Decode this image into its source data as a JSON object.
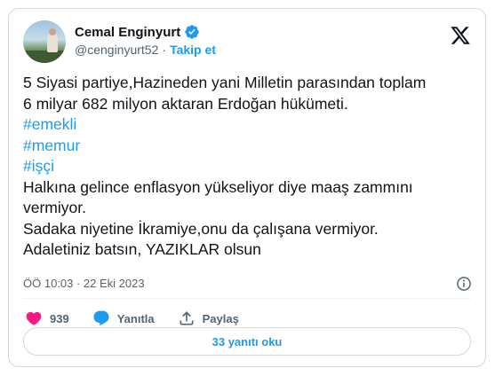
{
  "author": {
    "name": "Cemal Enginyurt",
    "handle": "@cenginyurt52",
    "separator": "·",
    "follow_label": "Takip et",
    "verified_color": "#1d9bf0"
  },
  "tweet": {
    "lines": [
      {
        "text": "5 Siyasi partiye,Hazineden yani Milletin parasından toplam",
        "type": "text"
      },
      {
        "text": "6 milyar 682 milyon aktaran Erdoğan hükümeti.",
        "type": "text"
      },
      {
        "text": "#emekli",
        "type": "hashtag"
      },
      {
        "text": "#memur",
        "type": "hashtag"
      },
      {
        "text": "#işçi",
        "type": "hashtag"
      },
      {
        "text": "Halkına gelince enflasyon yükseliyor diye maaş zammını",
        "type": "text"
      },
      {
        "text": "vermiyor.",
        "type": "text"
      },
      {
        "text": "Sadaka niyetine İkramiye,onu da çalışana vermiyor.",
        "type": "text"
      },
      {
        "text": "Adaletiniz batsın, YAZIKLAR olsun",
        "type": "text"
      }
    ],
    "timestamp": "ÖÖ 10:03 · 22 Eki 2023"
  },
  "actions": {
    "like_count": "939",
    "reply_label": "Yanıtla",
    "share_label": "Paylaş"
  },
  "replies_button_label": "33 yanıtı oku",
  "colors": {
    "accent": "#1d9bf0",
    "like": "#f91880",
    "text": "#0f1419",
    "muted": "#536471"
  }
}
